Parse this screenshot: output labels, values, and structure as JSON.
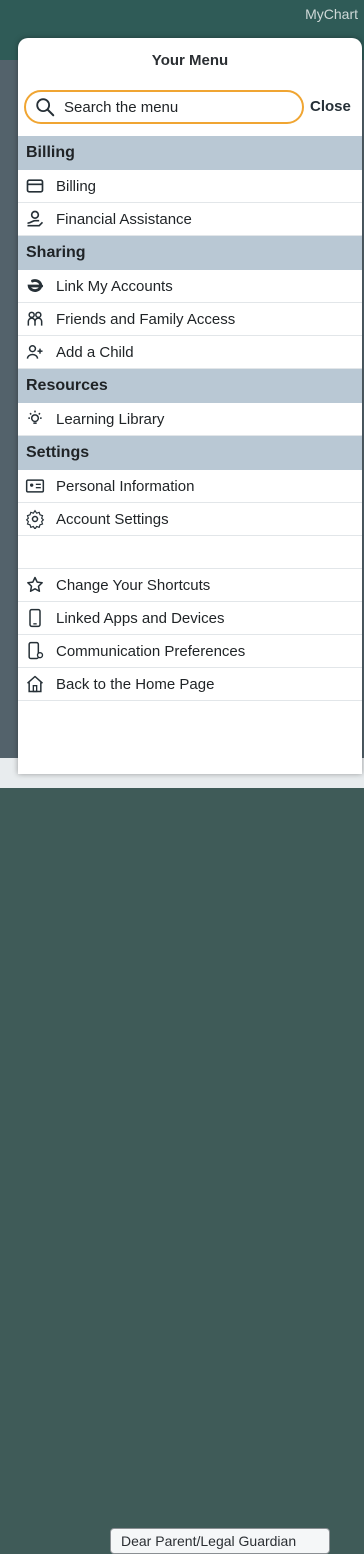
{
  "backdrop": {
    "app_title": "MyChart",
    "letter_text": "Dear Parent/Legal Guardian"
  },
  "menu": {
    "title": "Your Menu",
    "search": {
      "placeholder": "Search the menu",
      "value": ""
    },
    "close_label": "Close",
    "sections": [
      {
        "title": "Billing",
        "items": [
          {
            "label": "Billing",
            "icon": "credit-card-icon"
          },
          {
            "label": "Financial Assistance",
            "icon": "hand-coin-icon"
          }
        ]
      },
      {
        "title": "Sharing",
        "items": [
          {
            "label": "Link My Accounts",
            "icon": "link-e-icon"
          },
          {
            "label": "Friends and Family Access",
            "icon": "people-group-icon"
          },
          {
            "label": "Add a Child",
            "icon": "add-person-icon"
          }
        ]
      },
      {
        "title": "Resources",
        "items": [
          {
            "label": "Learning Library",
            "icon": "lightbulb-icon"
          }
        ]
      },
      {
        "title": "Settings",
        "items": [
          {
            "label": "Personal Information",
            "icon": "id-card-icon"
          },
          {
            "label": "Account Settings",
            "icon": "gear-icon"
          },
          {
            "label": "",
            "icon": "blank-icon"
          },
          {
            "label": "Change Your Shortcuts",
            "icon": "star-outline-icon"
          },
          {
            "label": "Linked Apps and Devices",
            "icon": "phone-icon"
          },
          {
            "label": "Communication Preferences",
            "icon": "phone-settings-icon"
          },
          {
            "label": "Back to the Home Page",
            "icon": "home-icon"
          }
        ]
      }
    ]
  }
}
